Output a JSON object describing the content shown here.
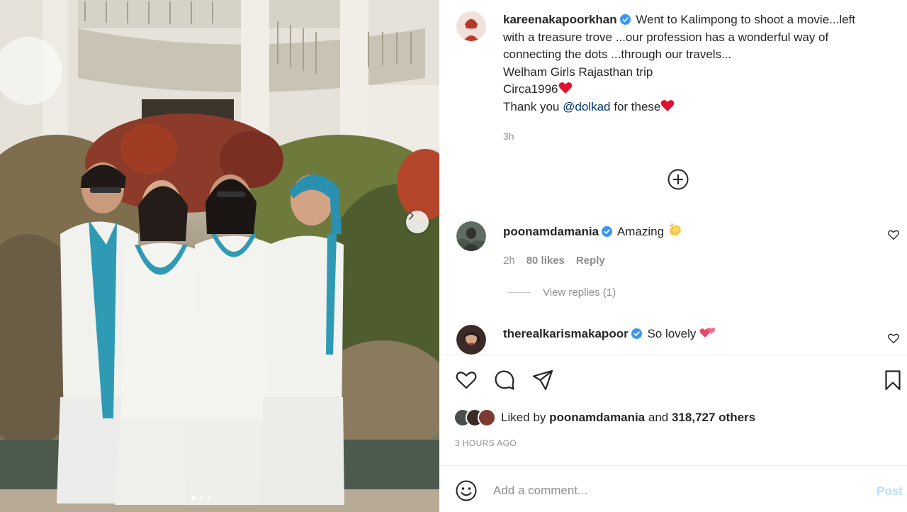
{
  "post": {
    "author": "kareenakapoorkhan",
    "caption_lines": [
      "Went to Kalimpong to shoot a movie...left",
      "with a treasure trove ...our profession has a wonderful way of",
      "connecting the dots ...through our travels...",
      "Welham Girls Rajasthan trip",
      "Circa1996",
      "Thank you"
    ],
    "mention": "@dolkad",
    "caption_end": "for these",
    "relative_time": "3h"
  },
  "comments": [
    {
      "author": "poonamdamania",
      "text": "Amazing",
      "time": "2h",
      "likes": "80 likes",
      "reply_label": "Reply",
      "view_replies": "View replies (1)"
    },
    {
      "author": "therealkarismakapoor",
      "text": "So lovely"
    }
  ],
  "likes": {
    "prefix": "Liked by",
    "user": "poonamdamania",
    "and": "and",
    "others": "318,727 others"
  },
  "post_time": "3 HOURS AGO",
  "add_comment": {
    "placeholder": "Add a comment...",
    "post_label": "Post"
  },
  "carousel": {
    "total_slides": 3,
    "active_index": 0
  },
  "colors": {
    "verified": "#3897f0",
    "mention": "#00376b",
    "muted": "#8e8e8e",
    "post_disabled": "#b2dffc",
    "heart_emoji": "#e0102f",
    "uniform_sash": "#2e9ab3"
  },
  "icons": [
    "add-comments-icon",
    "heart-icon",
    "comment-icon",
    "share-icon",
    "bookmark-icon",
    "emoji-icon",
    "chevron-right-icon",
    "verified-icon"
  ]
}
